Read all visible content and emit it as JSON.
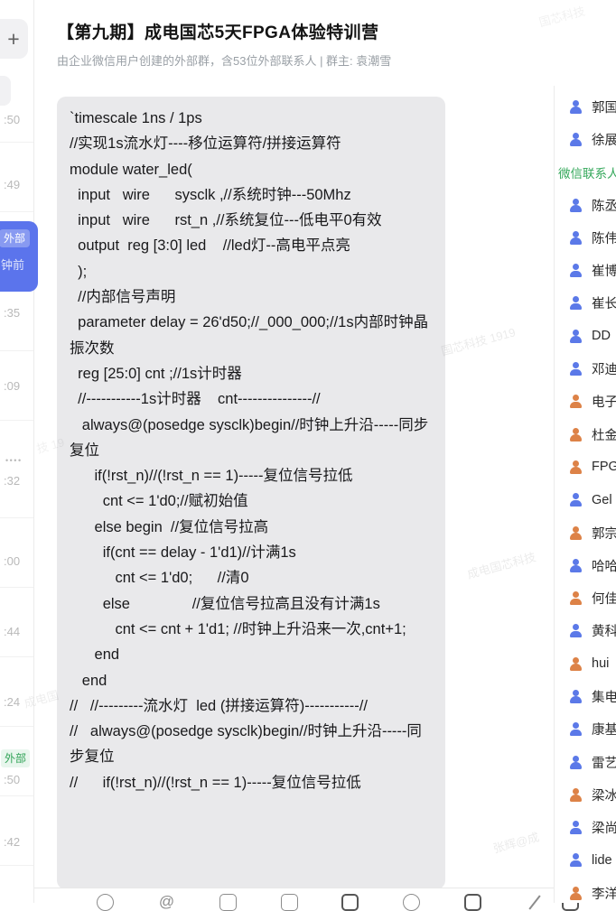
{
  "header": {
    "title": "【第九期】成电国芯5天FPGA体验特训营",
    "subtitle": "由企业微信用户创建的外部群，含53位外部联系人 | 群主: 袁潮雪"
  },
  "chat_list": {
    "add_button_label": "+",
    "items": [
      {
        "kind": "time",
        "label": ":50"
      },
      {
        "kind": "time",
        "label": ":49"
      },
      {
        "kind": "selected",
        "badge": "外部",
        "label": "钟前"
      },
      {
        "kind": "time",
        "label": ":35"
      },
      {
        "kind": "time",
        "label": ":09"
      },
      {
        "kind": "dots",
        "dots": "••••",
        "label": ":32"
      },
      {
        "kind": "time",
        "label": ":00"
      },
      {
        "kind": "time",
        "label": ":44"
      },
      {
        "kind": "time",
        "label": ":24"
      },
      {
        "kind": "ext",
        "badge": "外部",
        "label": ":50"
      },
      {
        "kind": "time",
        "label": ":42"
      }
    ],
    "selected_color": "#5B74EC",
    "external_badge_color": "#31A357"
  },
  "message": {
    "code_lines": [
      "`timescale 1ns / 1ps",
      "//实现1s流水灯----移位运算符/拼接运算符",
      "module water_led(",
      "  input   wire      sysclk ,//系统时钟---50Mhz",
      "  input   wire      rst_n ,//系统复位---低电平0有效",
      "  output  reg [3:0] led    //led灯--高电平点亮",
      "  );",
      "  //内部信号声明",
      "  parameter delay = 26'd50;//_000_000;//1s内部时钟晶振次数",
      "  reg [25:0] cnt ;//1s计时器",
      "  //-----------1s计时器    cnt---------------//",
      "   always@(posedge sysclk)begin//时钟上升沿-----同步复位",
      "      if(!rst_n)//(!rst_n == 1)-----复位信号拉低",
      "        cnt <= 1'd0;//赋初始值",
      "      else begin  //复位信号拉高",
      "        if(cnt == delay - 1'd1)//计满1s",
      "           cnt <= 1'd0;      //清0",
      "        else               //复位信号拉高且没有计满1s",
      "           cnt <= cnt + 1'd1; //时钟上升沿来一次,cnt+1;",
      "      end",
      "   end",
      "//   //---------流水灯  led (拼接运算符)-----------//",
      "//   always@(posedge sysclk)begin//时钟上升沿-----同步复位",
      "//      if(!rst_n)//(!rst_n == 1)-----复位信号拉低"
    ]
  },
  "members": {
    "section_header": "微信联系人",
    "blue": "#5B79E8",
    "orange": "#DD8247",
    "rows": [
      {
        "name": "郭国",
        "icon_color": "#5B79E8"
      },
      {
        "name": "徐展",
        "icon_color": "#5B79E8"
      },
      {
        "header": "微信联系人"
      },
      {
        "name": "陈丞",
        "icon_color": "#5B79E8"
      },
      {
        "name": "陈伟",
        "icon_color": "#5B79E8"
      },
      {
        "name": "崔博",
        "icon_color": "#5B79E8"
      },
      {
        "name": "崔长",
        "icon_color": "#5B79E8"
      },
      {
        "name": "DD",
        "icon_color": "#5B79E8"
      },
      {
        "name": "邓迪",
        "icon_color": "#5B79E8"
      },
      {
        "name": "电子",
        "icon_color": "#DD8247"
      },
      {
        "name": "杜金",
        "icon_color": "#DD8247"
      },
      {
        "name": "FPG",
        "icon_color": "#DD8247"
      },
      {
        "name": "Gel",
        "icon_color": "#5B79E8"
      },
      {
        "name": "郭宗",
        "icon_color": "#DD8247"
      },
      {
        "name": "哈哈",
        "icon_color": "#5B79E8"
      },
      {
        "name": "何佳",
        "icon_color": "#DD8247"
      },
      {
        "name": "黄科",
        "icon_color": "#5B79E8"
      },
      {
        "name": "hui",
        "icon_color": "#DD8247"
      },
      {
        "name": "集电",
        "icon_color": "#5B79E8"
      },
      {
        "name": "康基",
        "icon_color": "#5B79E8"
      },
      {
        "name": "雷艺",
        "icon_color": "#5B79E8"
      },
      {
        "name": "梁冰",
        "icon_color": "#DD8247"
      },
      {
        "name": "梁尚",
        "icon_color": "#5B79E8"
      },
      {
        "name": "lide",
        "icon_color": "#5B79E8"
      },
      {
        "name": "李洋",
        "icon_color": "#DD8247"
      }
    ]
  },
  "toolbar": {
    "icons": [
      {
        "name": "emoji-icon",
        "glyph": ""
      },
      {
        "name": "mention-icon",
        "glyph": "@"
      },
      {
        "name": "screenshot-icon",
        "glyph": ""
      },
      {
        "name": "file-icon",
        "glyph": ""
      },
      {
        "name": "image-icon",
        "glyph": ""
      },
      {
        "name": "history-icon",
        "glyph": ""
      },
      {
        "name": "chat-record-icon",
        "glyph": ""
      },
      {
        "name": "signature-icon",
        "glyph": ""
      },
      {
        "name": "video-icon",
        "glyph": ""
      }
    ]
  },
  "watermarks": [
    {
      "text": "国芯科技 1919"
    },
    {
      "text": "成电国芯科技"
    },
    {
      "text": "张辉@成"
    },
    {
      "text": "成电国"
    },
    {
      "text": "技 19"
    },
    {
      "text": "国芯科技"
    }
  ]
}
